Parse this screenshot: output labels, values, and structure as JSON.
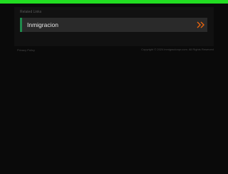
{
  "colors": {
    "top_bar": "#22dd22",
    "accent": "#1f8a4c",
    "chevron": "#e8650f"
  },
  "section": {
    "label": "Related Links"
  },
  "links": [
    {
      "label": "Inmigracion",
      "icon": "double-chevron-right-icon"
    }
  ],
  "footer": {
    "privacy_label": "Privacy Policy",
    "copyright": "Copyright © 2024 inmigracionpr.com. All Rights Reserved"
  }
}
